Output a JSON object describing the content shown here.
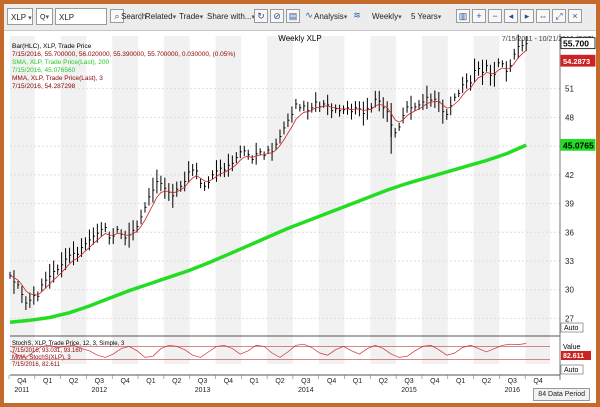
{
  "toolbar": {
    "symbol_label": "XLP",
    "search_symbol_value": "XLP",
    "search_label": "Search",
    "related_label": "Related",
    "trade_label": "Trade",
    "share_label": "Share with...",
    "analysis_label": "Analysis",
    "period_label": "Weekly",
    "range_label": "5 Years"
  },
  "chart_data": {
    "type": "line",
    "title": "Weekly XLP",
    "date_range": "7/15/2011 - 10/21/2016 (EST)",
    "legend": [
      {
        "text": "Bar(HLC), XLP, Trade Price",
        "color": "#000000"
      },
      {
        "text": "7/15/2016, 55.700000, 56.020000, 55.390000, 55.700000, 0.030000, (0.05%)",
        "color": "#8b0000"
      },
      {
        "text": "SMA, XLP, Trade Price(Last), 200",
        "color": "#22cc22"
      },
      {
        "text": "7/15/2016, 45.076560",
        "color": "#22cc22"
      },
      {
        "text": "MMA, XLP, Trade Price(Last), 3",
        "color": "#8b0000"
      },
      {
        "text": "7/15/2016, 54.287298",
        "color": "#8b0000"
      }
    ],
    "y_ticks": [
      27,
      30,
      33,
      36,
      39,
      42,
      45,
      48,
      51
    ],
    "ylim": [
      26,
      56.5
    ],
    "price_badge": {
      "value": "55.700",
      "color": "#000000"
    },
    "mma_badge": {
      "value": "54.2873",
      "color": "#cc2222"
    },
    "sma_badge": {
      "value": "45.0765",
      "color": "#22dd22"
    },
    "auto_label": "Auto",
    "series": [
      {
        "name": "XLP",
        "color": "#000000",
        "x": [
          0,
          2,
          4,
          6,
          8,
          10,
          12,
          14,
          16,
          18,
          20,
          22,
          24,
          26,
          28,
          30,
          32,
          34,
          36,
          38,
          40,
          42,
          44,
          46,
          48,
          50,
          52,
          54,
          56,
          58,
          60,
          62,
          64,
          66,
          68,
          70,
          72,
          74,
          76,
          78,
          80,
          82,
          84,
          86,
          88,
          90,
          92,
          94,
          96,
          98,
          100,
          102,
          104,
          106,
          108,
          110,
          112,
          114,
          116,
          118,
          120,
          122,
          124,
          126,
          128,
          130,
          132,
          134,
          136,
          138,
          140,
          142,
          144,
          146,
          148,
          150,
          152,
          154,
          156,
          158,
          160,
          162,
          164,
          166,
          168,
          170,
          172,
          174,
          176,
          178,
          180,
          182,
          184,
          186,
          188,
          190,
          192,
          194,
          196,
          198,
          200,
          202,
          204,
          206,
          208,
          210,
          212,
          214,
          216,
          218,
          220,
          222,
          224,
          226,
          228,
          230,
          232,
          234,
          236,
          238,
          240,
          242,
          244,
          246,
          248,
          250,
          252,
          254,
          256,
          258,
          260
        ],
        "values": [
          31.5,
          30.8,
          30.5,
          29.5,
          28.6,
          28.9,
          29.4,
          29.3,
          30.5,
          31.0,
          31.4,
          31.9,
          32.1,
          32.6,
          33.2,
          33.6,
          33.8,
          33.7,
          34.4,
          34.8,
          35.2,
          35.6,
          35.9,
          36.3,
          36.5,
          35.4,
          35.6,
          36.3,
          35.8,
          35.4,
          35.7,
          36.2,
          36.6,
          37.6,
          38.6,
          39.7,
          40.4,
          41.3,
          41.1,
          40.6,
          40.2,
          39.8,
          40.5,
          40.8,
          41.3,
          42.3,
          42.5,
          42.4,
          41.1,
          40.8,
          41.2,
          42.0,
          42.4,
          42.7,
          42.5,
          43.0,
          43.2,
          43.8,
          44.4,
          44.5,
          44.1,
          43.6,
          44.2,
          44.4,
          44.0,
          44.6,
          44.4,
          45.2,
          46.0,
          46.9,
          47.7,
          48.3,
          49.4,
          49.0,
          49.2,
          48.7,
          49.0,
          49.6,
          49.1,
          49.4,
          49.3,
          48.7,
          48.9,
          48.7,
          48.8,
          49.0,
          48.6,
          49.0,
          48.9,
          48.4,
          48.9,
          49.0,
          49.9,
          49.7,
          49.0,
          48.6,
          47.2,
          46.4,
          47.0,
          48.2,
          49.1,
          49.0,
          49.1,
          49.3,
          49.6,
          50.1,
          49.8,
          49.9,
          49.6,
          48.6,
          48.3,
          49.2,
          50.1,
          50.5,
          51.4,
          51.8,
          51.6,
          52.9,
          53.1,
          52.7,
          53.4,
          52.4,
          52.5,
          53.7,
          53.6,
          52.8,
          53.4,
          54.6,
          55.4,
          55.5,
          55.7
        ]
      },
      {
        "name": "SMA 200",
        "color": "#22dd22",
        "x": [
          0,
          10,
          20,
          30,
          40,
          50,
          60,
          70,
          80,
          90,
          100,
          110,
          120,
          130,
          140,
          150,
          160,
          170,
          180,
          190,
          200,
          210,
          220,
          230,
          240,
          250,
          260
        ],
        "values": [
          26.6,
          26.8,
          27.1,
          27.6,
          28.3,
          29.1,
          29.9,
          30.6,
          31.3,
          32.0,
          32.8,
          33.7,
          34.6,
          35.5,
          36.4,
          37.2,
          38.0,
          38.8,
          39.6,
          40.4,
          41.1,
          41.7,
          42.3,
          42.9,
          43.5,
          44.2,
          45.1
        ]
      }
    ],
    "x_labels": [
      {
        "x": 6,
        "label": "Q4"
      },
      {
        "x": 19,
        "label": "Q1"
      },
      {
        "x": 32,
        "label": "Q2"
      },
      {
        "x": 45,
        "label": "Q3"
      },
      {
        "x": 58,
        "label": "Q4"
      },
      {
        "x": 71,
        "label": "Q1"
      },
      {
        "x": 84,
        "label": "Q2"
      },
      {
        "x": 97,
        "label": "Q3"
      },
      {
        "x": 110,
        "label": "Q4"
      },
      {
        "x": 123,
        "label": "Q1"
      },
      {
        "x": 136,
        "label": "Q2"
      },
      {
        "x": 149,
        "label": "Q3"
      },
      {
        "x": 162,
        "label": "Q4"
      },
      {
        "x": 175,
        "label": "Q1"
      },
      {
        "x": 188,
        "label": "Q2"
      },
      {
        "x": 201,
        "label": "Q3"
      },
      {
        "x": 214,
        "label": "Q4"
      },
      {
        "x": 227,
        "label": "Q1"
      },
      {
        "x": 240,
        "label": "Q2"
      },
      {
        "x": 253,
        "label": "Q3"
      },
      {
        "x": 266,
        "label": "Q4"
      }
    ],
    "year_labels": [
      {
        "x": 6,
        "label": "2011"
      },
      {
        "x": 45,
        "label": "2012"
      },
      {
        "x": 97,
        "label": "2013"
      },
      {
        "x": 149,
        "label": "2014"
      },
      {
        "x": 201,
        "label": "2015"
      },
      {
        "x": 253,
        "label": "2016"
      }
    ],
    "xlim": [
      0,
      272
    ],
    "stoch": {
      "legend": [
        {
          "text": "StochS, XLP, Trade Price, 12, 3, Simple, 3",
          "color": "#000000"
        },
        {
          "text": "7/15/2016, 93.031, 93.160",
          "color": "#8b0000"
        },
        {
          "text": "MMA, StochS(XLP), 3",
          "color": "#8b0000"
        },
        {
          "text": "7/15/2016, 82.611",
          "color": "#8b0000"
        }
      ],
      "value_label": "Value",
      "value_badge": "82.611",
      "auto_label": "Auto",
      "series": [
        {
          "name": "StochS",
          "color": "#cc3333",
          "x": [
            0,
            4,
            8,
            12,
            16,
            20,
            24,
            28,
            32,
            36,
            40,
            44,
            48,
            52,
            56,
            60,
            64,
            68,
            72,
            76,
            80,
            84,
            88,
            92,
            96,
            100,
            104,
            108,
            112,
            116,
            120,
            124,
            128,
            132,
            136,
            140,
            144,
            148,
            152,
            156,
            160,
            164,
            168,
            172,
            176,
            180,
            184,
            188,
            192,
            196,
            200,
            204,
            208,
            212,
            216,
            220,
            224,
            228,
            232,
            236,
            240,
            244,
            248,
            252,
            256,
            260
          ],
          "values": [
            60,
            40,
            30,
            55,
            80,
            85,
            75,
            80,
            85,
            70,
            60,
            40,
            30,
            45,
            70,
            80,
            60,
            30,
            35,
            70,
            85,
            80,
            65,
            40,
            30,
            55,
            80,
            85,
            70,
            45,
            60,
            85,
            80,
            50,
            30,
            55,
            85,
            90,
            75,
            50,
            40,
            65,
            80,
            60,
            45,
            70,
            85,
            70,
            45,
            30,
            35,
            60,
            80,
            85,
            65,
            40,
            50,
            75,
            85,
            70,
            55,
            70,
            85,
            90,
            88,
            93
          ]
        }
      ]
    }
  },
  "footer": {
    "period_button": "84 Data Period"
  }
}
